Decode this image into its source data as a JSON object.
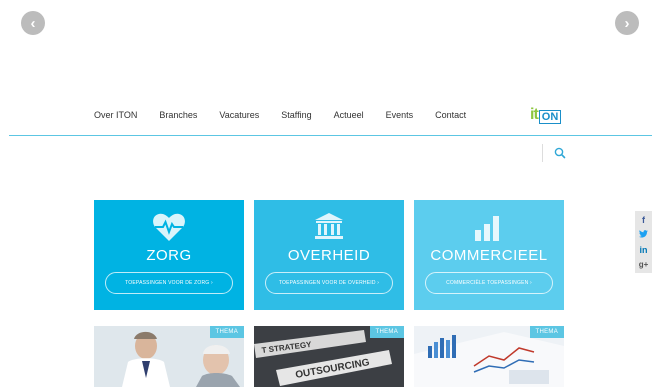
{
  "slider": {
    "prev_icon": "chevron-left-icon",
    "next_icon": "chevron-right-icon",
    "prev_glyph": "‹",
    "next_glyph": "›"
  },
  "nav": {
    "items": [
      "Over ITON",
      "Branches",
      "Vacatures",
      "Staffing",
      "Actueel",
      "Events",
      "Contact"
    ],
    "accent_color": "#5cc6e3"
  },
  "logo": {
    "part1": "it",
    "part2": "ON"
  },
  "search": {
    "icon": "search-icon"
  },
  "social": {
    "facebook": "f",
    "twitter": "t",
    "linkedin": "in",
    "googleplus": "g+"
  },
  "categories": [
    {
      "title": "ZORG",
      "button": "TOEPASSINGEN VOOR DE ZORG ›",
      "icon": "heart-pulse-icon",
      "color": "#00b3e3"
    },
    {
      "title": "OVERHEID",
      "button": "TOEPASSINGEN VOOR DE OVERHEID ›",
      "icon": "government-building-icon",
      "color": "#2fbde6"
    },
    {
      "title": "COMMERCIEEL",
      "button": "COMMERCIËLE TOEPASSINGEN ›",
      "icon": "bar-chart-icon",
      "color": "#5ccdee"
    }
  ],
  "themes": [
    {
      "tag": "THEMA"
    },
    {
      "tag": "THEMA",
      "image_text": "OUTSOURCING"
    },
    {
      "tag": "THEMA"
    }
  ]
}
